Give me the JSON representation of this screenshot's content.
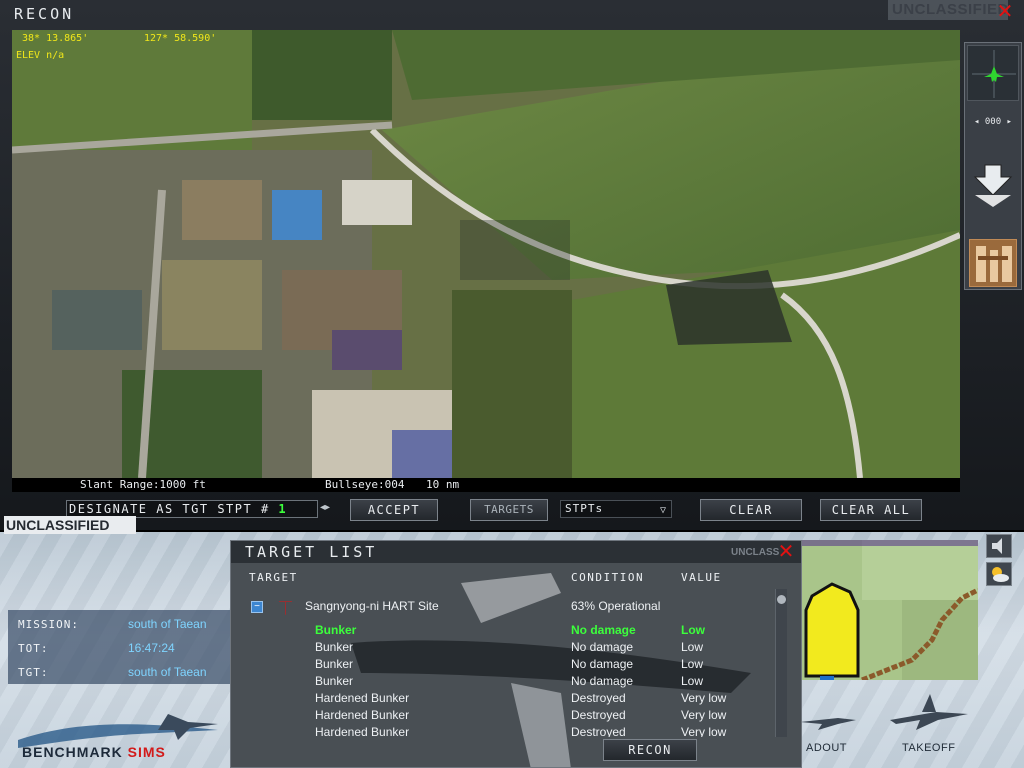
{
  "recon": {
    "title": "RECON",
    "classification": "UNCLASSIFIED",
    "coords": {
      "lat": "38* 13.865'",
      "lon": "127* 58.590'",
      "elev": "ELEV n/a"
    },
    "status": {
      "slant_range": "Slant Range:1000 ft",
      "bullseye": "Bullseye:004",
      "bullseye_range": "10 nm"
    },
    "heading": "000",
    "controls": {
      "designate_label": "DESIGNATE AS TGT STPT #",
      "stpt_number": "1",
      "accept": "ACCEPT",
      "targets": "TARGETS",
      "stpts": "STPTs",
      "clear": "CLEAR",
      "clear_all": "CLEAR ALL"
    }
  },
  "classification_bar": "UNCLASSIFIED",
  "mission_info": {
    "mission_label": "MISSION:",
    "mission_value": "south of Taean",
    "tot_label": "TOT:",
    "tot_value": "16:47:24",
    "tgt_label": "TGT:",
    "tgt_value": "south of Taean"
  },
  "logo": {
    "part1": "BENCHMARK ",
    "part2": "SIMS"
  },
  "bottom_labels": {
    "loadout": "ADOUT",
    "takeoff": "TAKEOFF"
  },
  "target_list": {
    "title": "TARGET LIST",
    "overlay_text": "UNCLASS",
    "columns": {
      "target": "TARGET",
      "condition": "CONDITION",
      "value": "VALUE"
    },
    "site": {
      "name": "Sangnyong-ni HART Site",
      "condition": "63% Operational",
      "collapse": "−"
    },
    "rows": [
      {
        "target": "Bunker",
        "condition": "No damage",
        "value": "Low",
        "selected": true
      },
      {
        "target": "Bunker",
        "condition": "No damage",
        "value": "Low",
        "selected": false
      },
      {
        "target": "Bunker",
        "condition": "No damage",
        "value": "Low",
        "selected": false
      },
      {
        "target": "Bunker",
        "condition": "No damage",
        "value": "Low",
        "selected": false
      },
      {
        "target": "Hardened Bunker",
        "condition": "Destroyed",
        "value": "Very low",
        "selected": false
      },
      {
        "target": "Hardened Bunker",
        "condition": "Destroyed",
        "value": "Very low",
        "selected": false
      },
      {
        "target": "Hardened Bunker",
        "condition": "Destroyed",
        "value": "Very low",
        "selected": false
      }
    ],
    "recon_button": "RECON"
  },
  "colors": {
    "selected_row": "#3cff3c",
    "row_text": "#eef1f4",
    "coords": "#f0e61a",
    "mission_value": "#7fd4ff",
    "close": "#e21212"
  },
  "icons": [
    "close-icon",
    "aircraft-icon",
    "down-arrow-icon",
    "building-icon",
    "bomb-icon",
    "weather-icon",
    "speaker-icon",
    "collapse-icon"
  ]
}
